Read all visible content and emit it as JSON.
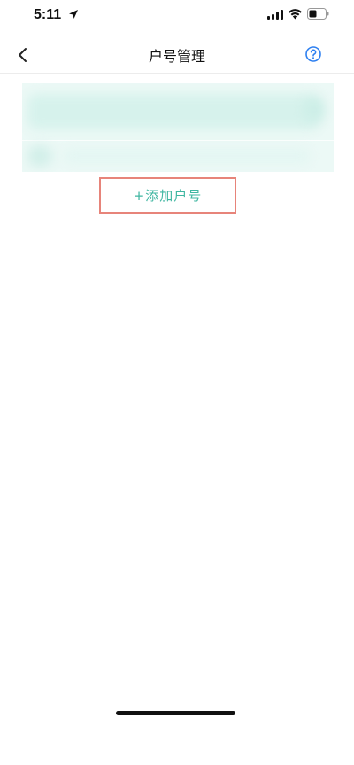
{
  "status_bar": {
    "time": "5:11",
    "icons": [
      "location-arrow-icon",
      "signal-icon",
      "wifi-icon",
      "battery-icon"
    ]
  },
  "nav": {
    "title": "户号管理",
    "back_icon": "chevron-left-icon",
    "help_icon": "help-circle-icon"
  },
  "account_card": {
    "content": "blurred"
  },
  "add_button": {
    "label": "+添加户号"
  },
  "colors": {
    "accent": "#3fb6a1",
    "help_blue": "#2d7ff0",
    "card_bg": "#ecf9f6",
    "highlight_border": "#e7847a"
  }
}
